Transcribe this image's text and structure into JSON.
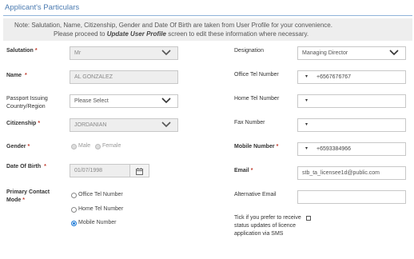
{
  "section": {
    "title": "Applicant's Particulars"
  },
  "note": {
    "line1": "Note: Salutation, Name, Citizenship, Gender and Date Of Birth are taken from User Profile for your convenience.",
    "line2_pre": "Please proceed to ",
    "line2_link": "Update User Profile",
    "line2_post": " screen to edit these information where necessary."
  },
  "fields": {
    "salutation": {
      "label": "Salutation",
      "value": "Mr"
    },
    "name": {
      "label": "Name",
      "value": "AL GONZALEZ"
    },
    "passport": {
      "label": "Passport Issuing Country/Region",
      "value": "Please Select"
    },
    "citizenship": {
      "label": "Citizenship",
      "value": "JORDANIAN"
    },
    "gender": {
      "label": "Gender",
      "options": [
        "Male",
        "Female"
      ]
    },
    "dob": {
      "label": "Date Of Birth",
      "value": "01/07/1998"
    },
    "contact_mode": {
      "label": "Primary Contact Mode",
      "options": [
        "Office Tel Number",
        "Home Tel Number",
        "Mobile Number"
      ],
      "selected": "Mobile Number"
    },
    "designation": {
      "label": "Designation",
      "value": "Managing Director"
    },
    "office_tel": {
      "label": "Office Tel Number",
      "prefix": "▾",
      "value": "+6567676767"
    },
    "home_tel": {
      "label": "Home Tel Number",
      "prefix": "▾",
      "value": ""
    },
    "fax": {
      "label": "Fax Number",
      "prefix": "▾",
      "value": ""
    },
    "mobile": {
      "label": "Mobile Number",
      "prefix": "▾",
      "value": "+6593384966"
    },
    "email": {
      "label": "Email",
      "value": "stb_ta_licensee1d@public.com"
    },
    "alt_email": {
      "label": "Alternative Email",
      "value": ""
    },
    "sms_opt": {
      "label": "Tick if you prefer to receive status updates of licence application via SMS",
      "checked": false
    }
  },
  "colors": {
    "accent": "#4a7ab0",
    "required": "#c0392b",
    "radio_selected": "#1e7bd8"
  }
}
